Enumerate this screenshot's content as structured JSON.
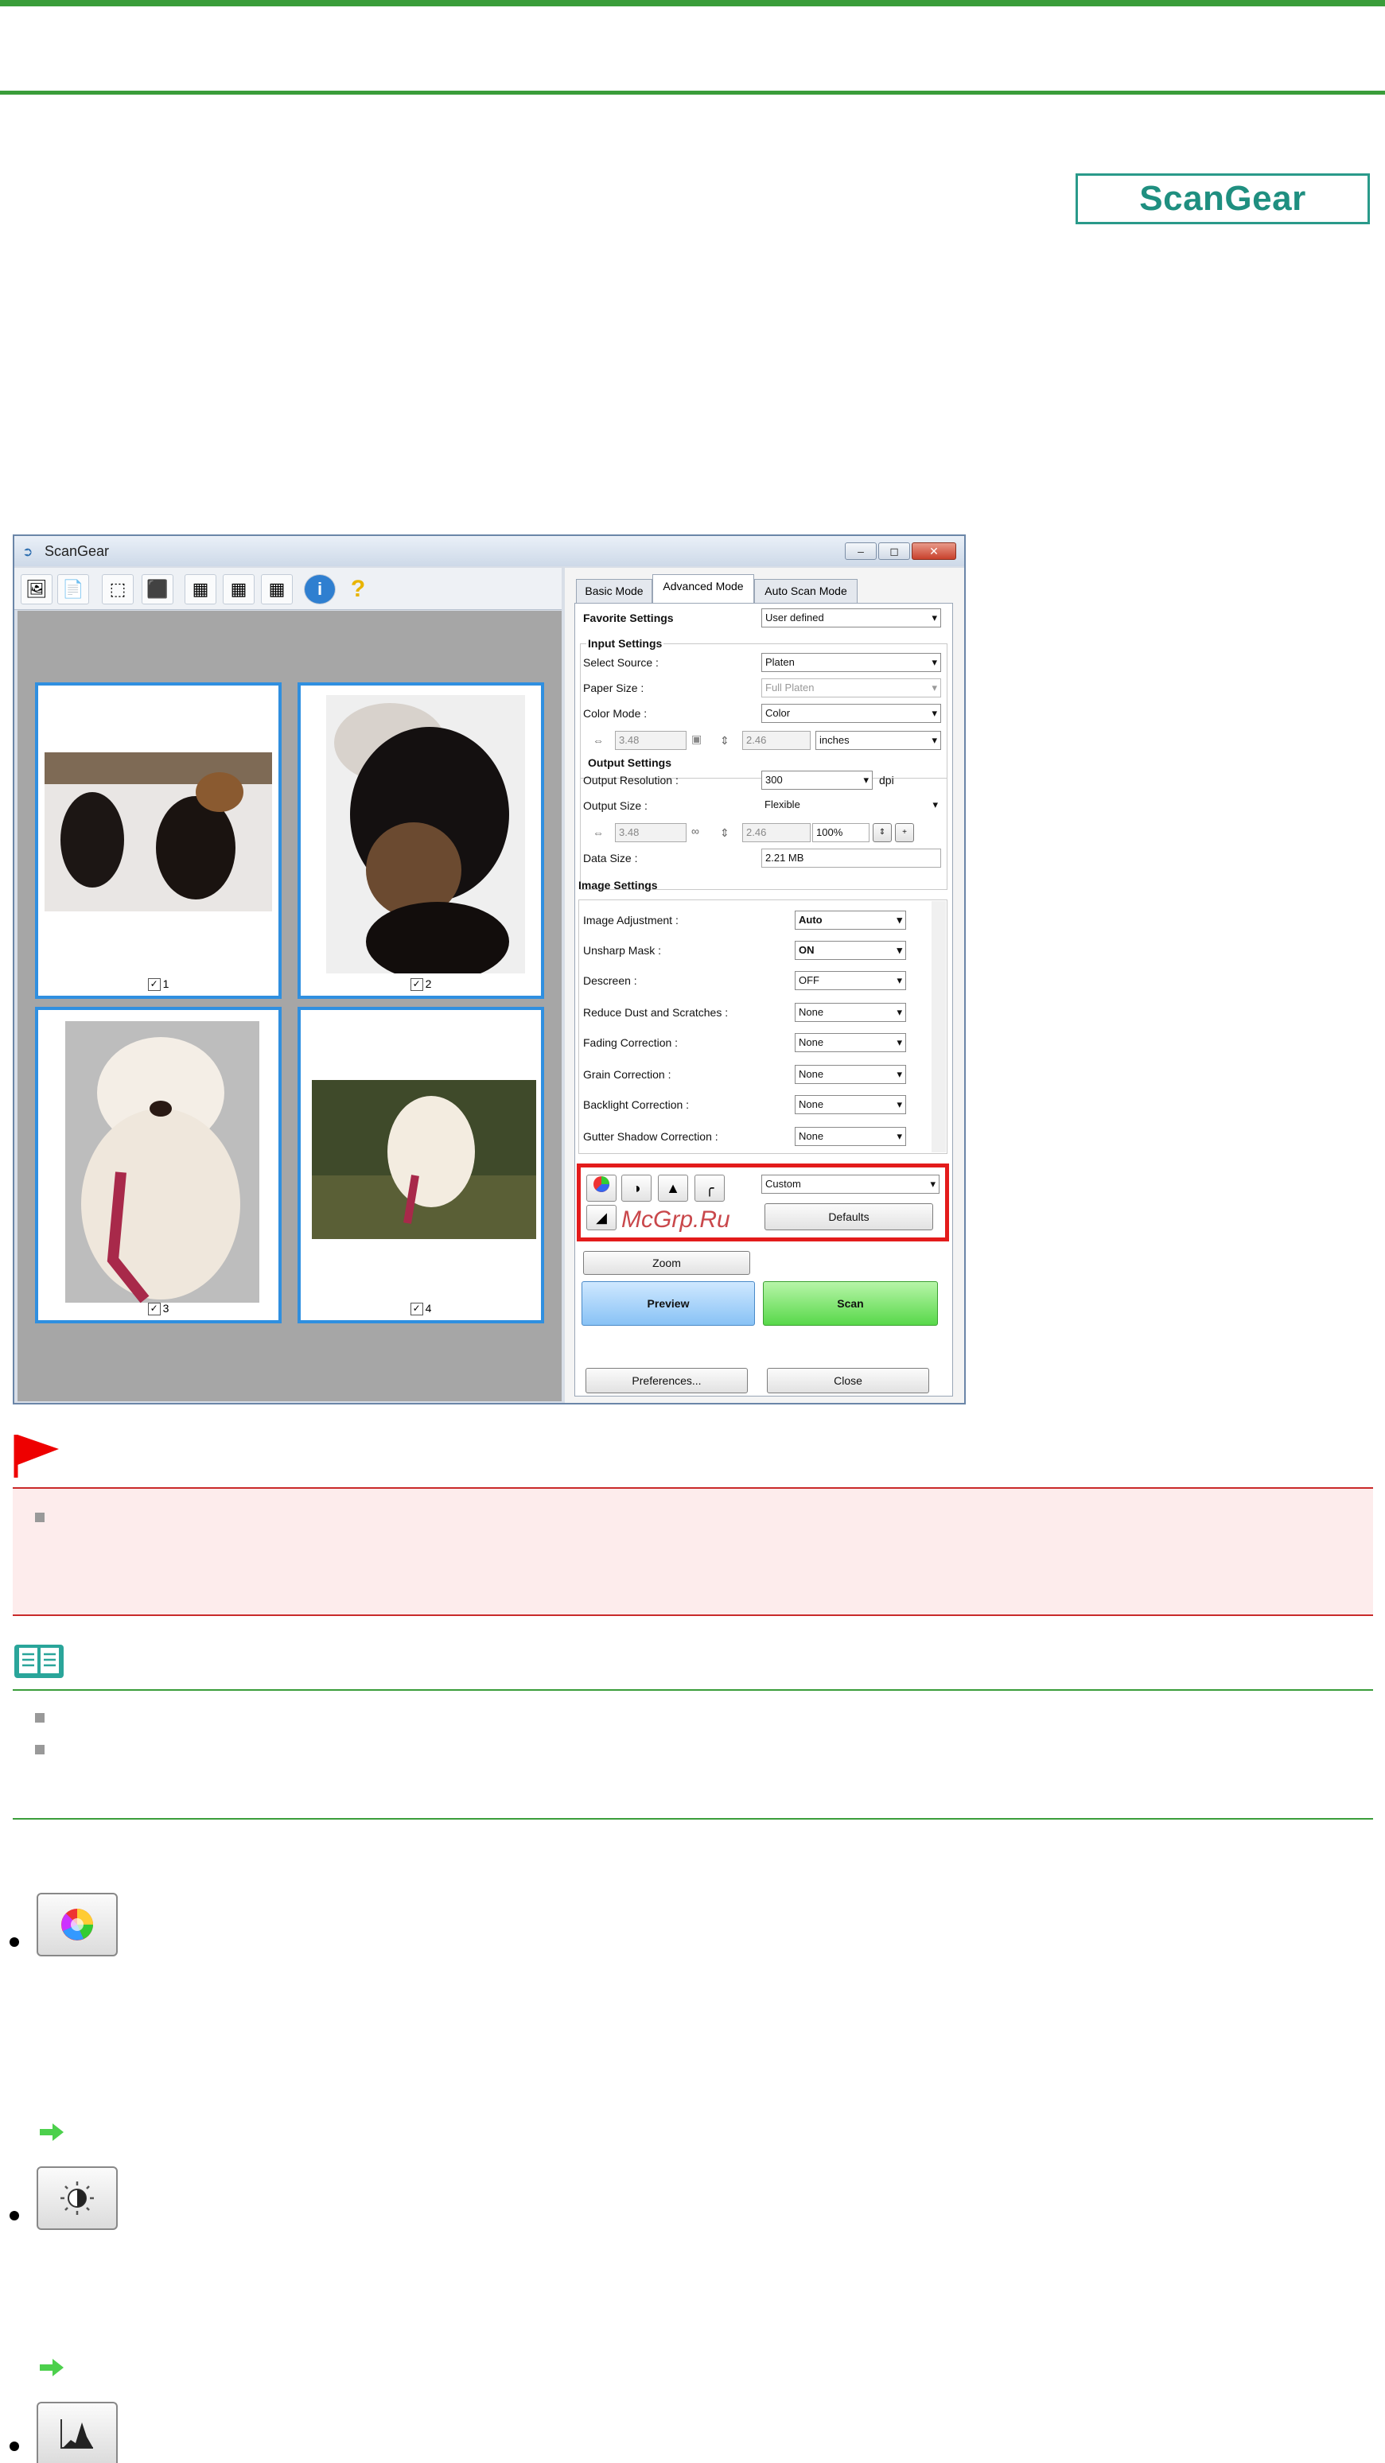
{
  "header": {
    "logo_text": "ScanGear"
  },
  "window": {
    "title": "ScanGear",
    "controls": [
      "–",
      "◻",
      "✕"
    ],
    "toolbar_icons": [
      "rotate-left-icon",
      "rotate-right-icon",
      "auto-crop-icon",
      "remove-crop-icon",
      "mirror-icon",
      "invert-icon",
      "thumbnail-icon",
      "whole-image-icon",
      "multi-crop-icon",
      "info-icon",
      "help-icon"
    ],
    "thumbnails": [
      {
        "label": "1"
      },
      {
        "label": "2"
      },
      {
        "label": "3"
      },
      {
        "label": "4"
      }
    ],
    "tabs": [
      "Basic Mode",
      "Advanced Mode",
      "Auto Scan Mode"
    ],
    "favorite": {
      "label": "Favorite Settings",
      "value": "User defined"
    },
    "input": {
      "heading": "Input Settings",
      "select_source": {
        "label": "Select Source :",
        "value": "Platen"
      },
      "paper_size": {
        "label": "Paper Size :",
        "value": "Full Platen"
      },
      "color_mode": {
        "label": "Color Mode :",
        "value": "Color"
      },
      "width": "3.48",
      "height": "2.46",
      "unit": "inches"
    },
    "output": {
      "heading": "Output Settings",
      "resolution": {
        "label": "Output Resolution :",
        "value": "300",
        "unit": "dpi"
      },
      "size": {
        "label": "Output Size :",
        "value": "Flexible"
      },
      "width": "3.48",
      "height": "2.46",
      "scale": "100%",
      "data_size": {
        "label": "Data Size :",
        "value": "2.21 MB"
      }
    },
    "image_settings": {
      "heading": "Image Settings",
      "rows": [
        {
          "label": "Image Adjustment :",
          "value": "Auto"
        },
        {
          "label": "Unsharp Mask :",
          "value": "ON"
        },
        {
          "label": "Descreen :",
          "value": "OFF"
        },
        {
          "label": "Reduce Dust and Scratches :",
          "value": "None"
        },
        {
          "label": "Fading Correction :",
          "value": "None"
        },
        {
          "label": "Grain Correction :",
          "value": "None"
        },
        {
          "label": "Backlight Correction :",
          "value": "None"
        },
        {
          "label": "Gutter Shadow Correction :",
          "value": "None"
        }
      ]
    },
    "adjust": {
      "preset": "Custom",
      "defaults": "Defaults",
      "watermark": "McGrp.Ru"
    },
    "buttons": {
      "zoom": "Zoom",
      "preview": "Preview",
      "scan": "Scan",
      "preferences": "Preferences...",
      "close": "Close"
    }
  },
  "colors": {
    "accent_green": "#3a9d3a",
    "warning_red": "#c92a2a",
    "highlight": "#e31b1b",
    "selection_blue": "#2f8fe0"
  }
}
